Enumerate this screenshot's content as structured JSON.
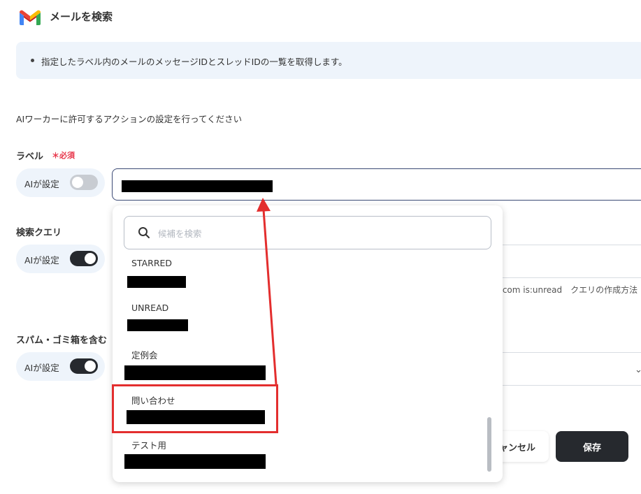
{
  "header": {
    "title": "メールを検索",
    "logo_icon": "gmail-icon"
  },
  "info": {
    "bullet_text": "指定したラベル内のメールのメッセージIDとスレッドIDの一覧を取得します。"
  },
  "instruction": "AIワーカーに許可するアクションの設定を行ってください",
  "fields": {
    "label": {
      "title": "ラベル",
      "required": "＊必須",
      "ai_toggle": {
        "label": "AIが設定",
        "on": false
      }
    },
    "query": {
      "title": "検索クエリ",
      "ai_toggle": {
        "label": "AIが設定",
        "on": true
      },
      "hint": ".com is:unread　クエリの作成方法"
    },
    "spam": {
      "title": "スパム・ゴミ箱を含む",
      "ai_toggle": {
        "label": "AIが設定",
        "on": true
      }
    }
  },
  "dropdown": {
    "search_placeholder": "候補を検索",
    "items": [
      {
        "label": "STARRED"
      },
      {
        "label": "UNREAD"
      },
      {
        "label": "定例会"
      },
      {
        "label": "問い合わせ",
        "highlighted": true
      },
      {
        "label": "テスト用"
      }
    ]
  },
  "actions": {
    "cancel": "ャンセル",
    "save": "保存"
  },
  "colors": {
    "accent_dark": "#26292e",
    "required_red": "#e8364a",
    "annotation_red": "#e32e2e",
    "info_bg": "#eef4fb"
  }
}
